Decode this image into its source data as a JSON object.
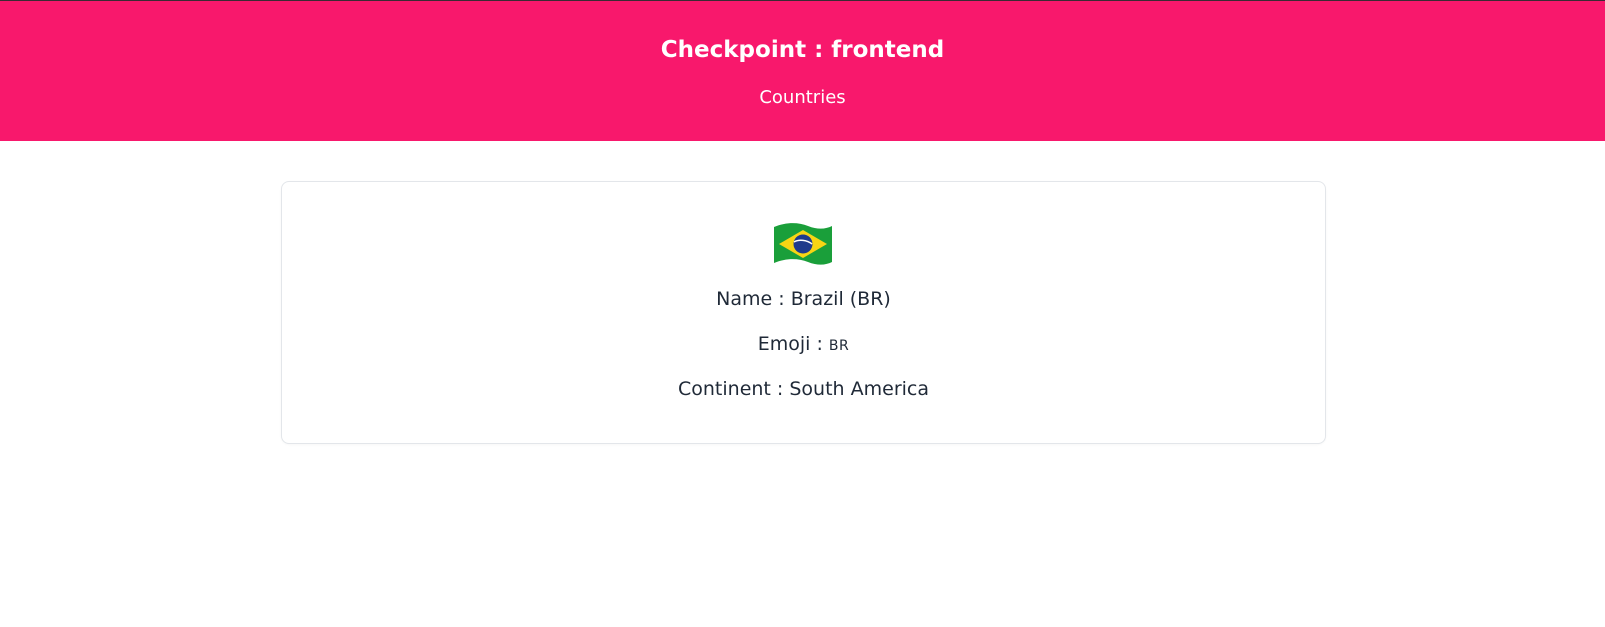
{
  "header": {
    "title": "Checkpoint : frontend",
    "subtitle": "Countries"
  },
  "country": {
    "flag_icon": "brazil-flag",
    "name_label": "Name : ",
    "name_value": "Brazil (BR)",
    "emoji_label": "Emoji : ",
    "emoji_value": "BR",
    "continent_label": "Continent : ",
    "continent_value": "South America"
  },
  "colors": {
    "header_bg": "#f8186c",
    "header_text": "#ffffff",
    "card_border": "#e3e6ea",
    "text": "#1f2937"
  }
}
